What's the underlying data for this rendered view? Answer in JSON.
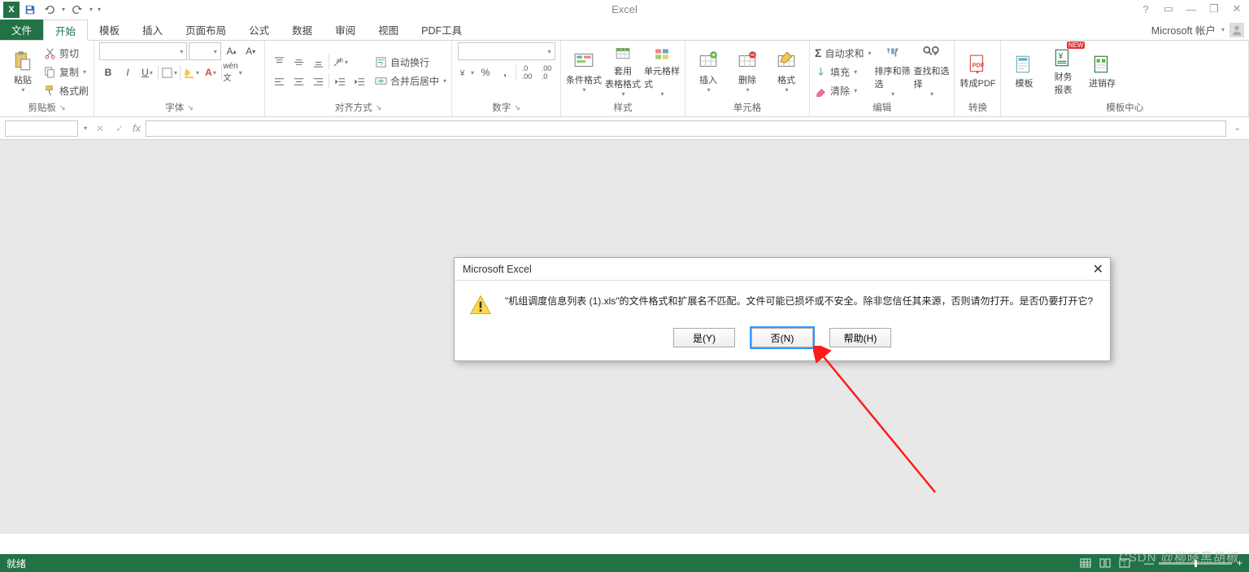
{
  "titlebar": {
    "app_title": "Excel"
  },
  "account": {
    "label": "Microsoft 帐户"
  },
  "tabs": {
    "file": "文件",
    "list": [
      "开始",
      "模板",
      "插入",
      "页面布局",
      "公式",
      "数据",
      "审阅",
      "视图",
      "PDF工具"
    ],
    "active_index": 0
  },
  "clipboard": {
    "group_label": "剪贴板",
    "paste": "粘贴",
    "cut": "剪切",
    "copy": "复制",
    "format_painter": "格式刷"
  },
  "font": {
    "group_label": "字体",
    "font_name": "",
    "font_size": ""
  },
  "alignment": {
    "group_label": "对齐方式",
    "wrap": "自动换行",
    "merge": "合并后居中"
  },
  "number": {
    "group_label": "数字",
    "format": ""
  },
  "styles": {
    "group_label": "样式",
    "cond": "条件格式",
    "table": "套用\n表格格式",
    "cell": "单元格样式"
  },
  "cells": {
    "group_label": "单元格",
    "insert": "插入",
    "delete": "删除",
    "format": "格式"
  },
  "editing": {
    "group_label": "编辑",
    "sum": "自动求和",
    "fill": "填充",
    "clear": "清除",
    "sort": "排序和筛选",
    "find": "查找和选择"
  },
  "convert": {
    "group_label": "转换",
    "pdf": "转成PDF"
  },
  "template_center": {
    "group_label": "模板中心",
    "template": "模板",
    "finance": "财务\n报表",
    "stock": "进销存",
    "new_badge": "NEW"
  },
  "dialog": {
    "title": "Microsoft Excel",
    "message": "\"机组调度信息列表 (1).xls\"的文件格式和扩展名不匹配。文件可能已损坏或不安全。除非您信任其来源，否则请勿打开。是否仍要打开它?",
    "yes": "是(Y)",
    "no": "否(N)",
    "help": "帮助(H)"
  },
  "status": {
    "ready": "就绪"
  },
  "watermark": "CSDN @柳晓黑胡椒"
}
